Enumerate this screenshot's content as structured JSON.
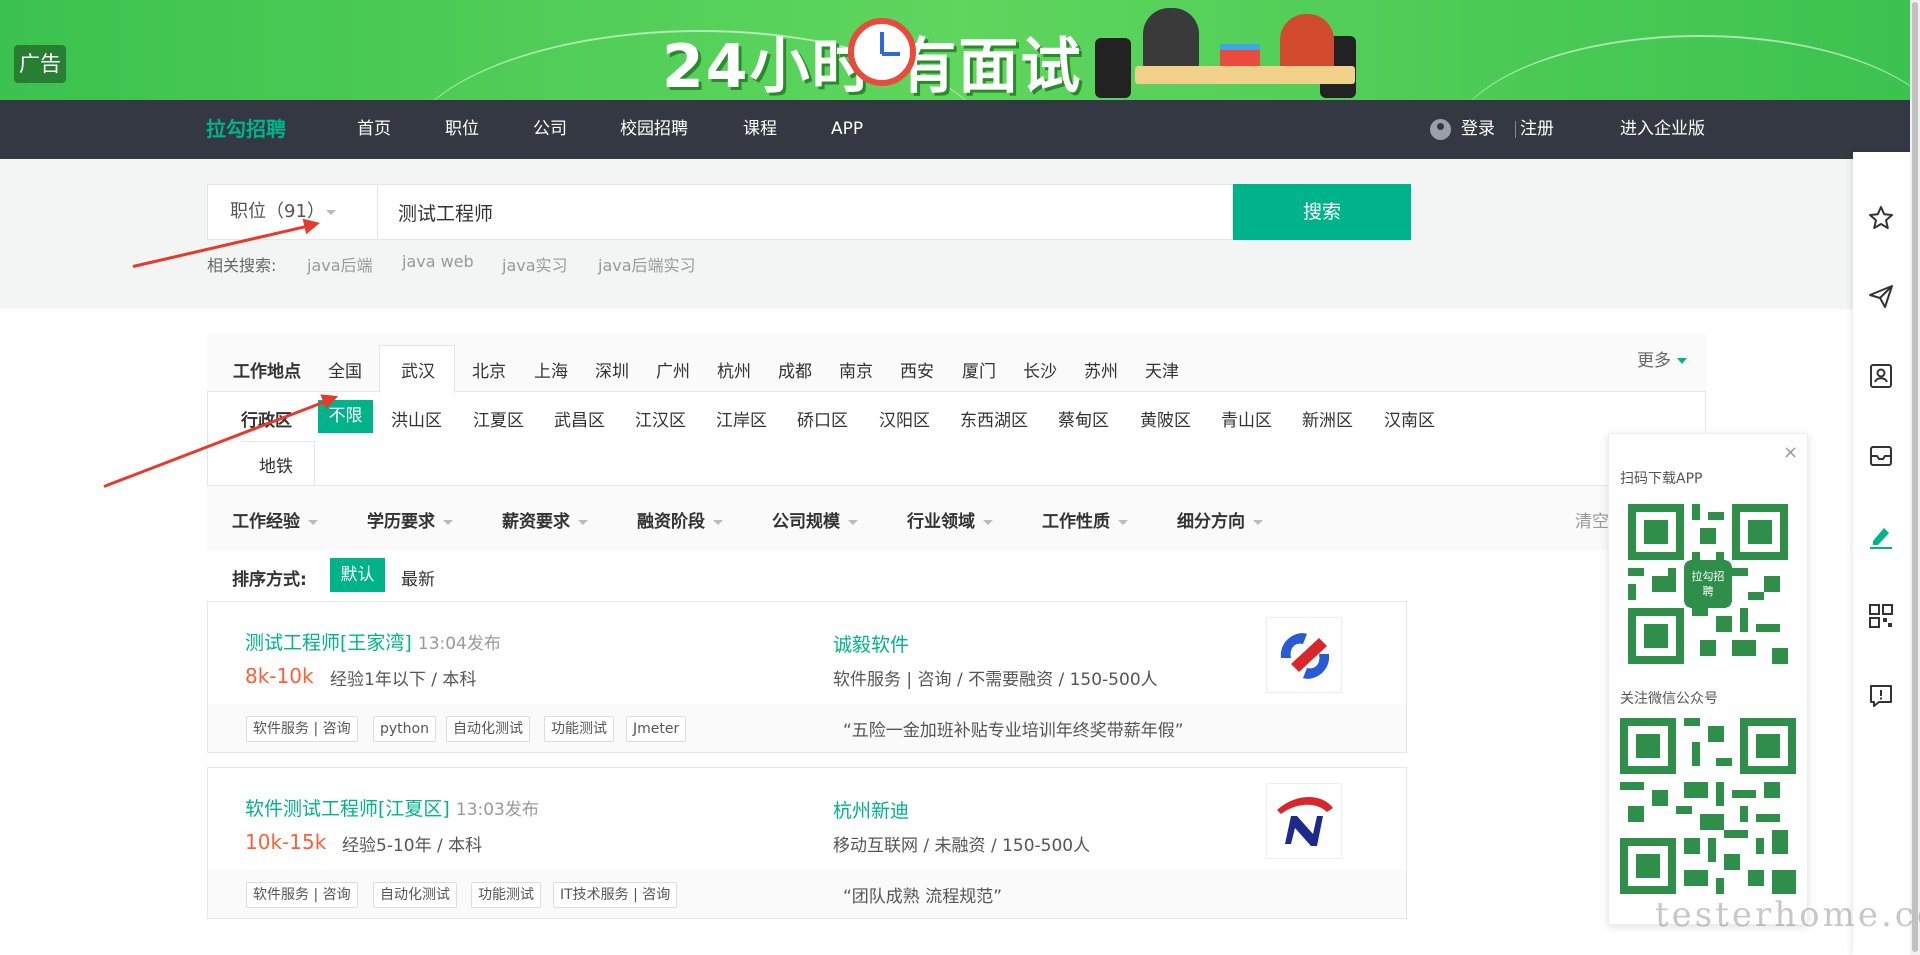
{
  "banner": {
    "ad_tag": "广告",
    "title": "24小时 有面试"
  },
  "nav": {
    "logo": "拉勾招聘",
    "items": [
      "首页",
      "职位",
      "公司",
      "校园招聘",
      "课程",
      "APP"
    ],
    "login": "登录",
    "register": "注册",
    "enterprise": "进入企业版"
  },
  "search": {
    "type_label": "职位（91）",
    "query": "测试工程师",
    "button": "搜索",
    "related_label": "相关搜索:",
    "related": [
      "java后端",
      "java web",
      "java实习",
      "java后端实习"
    ]
  },
  "filters": {
    "location_label": "工作地点",
    "cities": [
      "全国",
      "武汉",
      "北京",
      "上海",
      "深圳",
      "广州",
      "杭州",
      "成都",
      "南京",
      "西安",
      "厦门",
      "长沙",
      "苏州",
      "天津"
    ],
    "selected_city": "武汉",
    "more": "更多",
    "district_label": "行政区",
    "districts": [
      "不限",
      "洪山区",
      "江夏区",
      "武昌区",
      "江汉区",
      "江岸区",
      "硚口区",
      "汉阳区",
      "东西湖区",
      "蔡甸区",
      "黄陂区",
      "青山区",
      "新洲区",
      "汉南区"
    ],
    "selected_district": "不限",
    "metro": "地铁",
    "dropdowns": [
      "工作经验",
      "学历要求",
      "薪资要求",
      "融资阶段",
      "公司规模",
      "行业领域",
      "工作性质",
      "细分方向"
    ],
    "clear": "清空",
    "sort_label": "排序方式:",
    "sort_default": "默认",
    "sort_newest": "最新"
  },
  "jobs": [
    {
      "title": "测试工程师[王家湾]",
      "time": "13:04发布",
      "salary": "8k-10k",
      "requirement": "经验1年以下 / 本科",
      "company": "诚毅软件",
      "company_info": "软件服务 | 咨询 / 不需要融资 / 150-500人",
      "tags": [
        "软件服务 | 咨询",
        "python",
        "自动化测试",
        "功能测试",
        "Jmeter"
      ],
      "slogan": "“五险一金加班补贴专业培训年终奖带薪年假”"
    },
    {
      "title": "软件测试工程师[江夏区]",
      "time": "13:03发布",
      "salary": "10k-15k",
      "requirement": "经验5-10年 / 本科",
      "company": "杭州新迪",
      "company_info": "移动互联网 / 未融资 / 150-500人",
      "tags": [
        "软件服务 | 咨询",
        "自动化测试",
        "功能测试",
        "IT技术服务 | 咨询"
      ],
      "slogan": "“团队成熟 流程规范”"
    }
  ],
  "qr_panel": {
    "close": "×",
    "app_label": "扫码下载APP",
    "wechat_label": "关注微信公众号",
    "qr_center": "拉勾招聘"
  },
  "sidebar_icons": [
    "star-icon",
    "send-icon",
    "resume-icon",
    "inbox-icon",
    "edit-icon",
    "qrcode-icon",
    "feedback-icon"
  ],
  "watermark": "testerhome.com",
  "colors": {
    "brand": "#00b38a",
    "salary": "#fd5f39",
    "nav_bg": "#343842",
    "banner": "#4ccb55",
    "arrow": "#e53b2c"
  }
}
